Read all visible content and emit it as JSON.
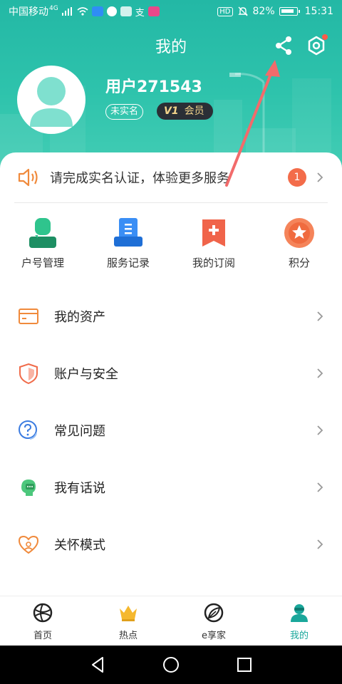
{
  "status_bar": {
    "carrier": "中国移动",
    "network": "4G",
    "battery": "82%",
    "time": "15:31",
    "hd": "HD"
  },
  "header": {
    "title": "我的",
    "username": "用户271543",
    "unverified_badge": "未实名",
    "vip_level": "V1",
    "vip_label": "会员"
  },
  "notice": {
    "text": "请完成实名认证，体验更多服务",
    "count": "1"
  },
  "quick_actions": [
    {
      "label": "户号管理",
      "icon": "user-card-icon"
    },
    {
      "label": "服务记录",
      "icon": "document-icon"
    },
    {
      "label": "我的订阅",
      "icon": "bookmark-plus-icon"
    },
    {
      "label": "积分",
      "icon": "star-icon"
    }
  ],
  "menu": [
    {
      "label": "我的资产",
      "icon": "card-icon"
    },
    {
      "label": "账户与安全",
      "icon": "shield-icon"
    },
    {
      "label": "常见问题",
      "icon": "question-icon"
    },
    {
      "label": "我有话说",
      "icon": "chat-head-icon"
    },
    {
      "label": "关怀模式",
      "icon": "heart-icon"
    }
  ],
  "bottom_nav": [
    {
      "label": "首页",
      "icon": "globe-icon"
    },
    {
      "label": "热点",
      "icon": "crown-icon"
    },
    {
      "label": "e享家",
      "icon": "leaf-icon"
    },
    {
      "label": "我的",
      "icon": "profile-icon"
    }
  ],
  "colors": {
    "brand_teal": "#23b8a5",
    "accent_orange": "#f36c4a",
    "active_nav": "#1aa79b"
  }
}
